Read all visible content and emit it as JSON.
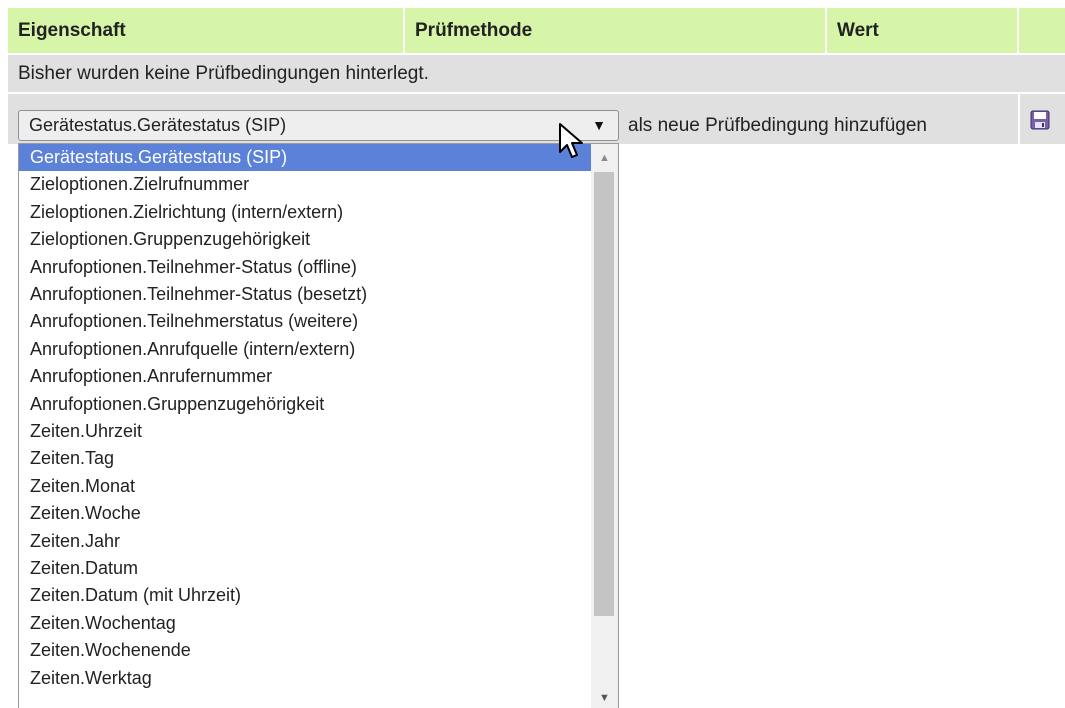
{
  "table": {
    "headers": [
      "Eigenschaft",
      "Prüfmethode",
      "Wert"
    ],
    "empty_message": "Bisher wurden keine Prüfbedingungen hinterlegt."
  },
  "add_condition": {
    "selected_value": "Gerätestatus.Gerätestatus (SIP)",
    "label": "als neue Prüfbedingung hinzufügen",
    "save_icon": "floppy-disk-save-icon"
  },
  "dropdown": {
    "selected_index": 0,
    "options": [
      "Gerätestatus.Gerätestatus (SIP)",
      "Zieloptionen.Zielrufnummer",
      "Zieloptionen.Zielrichtung (intern/extern)",
      "Zieloptionen.Gruppenzugehörigkeit",
      "Anrufoptionen.Teilnehmer-Status (offline)",
      "Anrufoptionen.Teilnehmer-Status (besetzt)",
      "Anrufoptionen.Teilnehmerstatus (weitere)",
      "Anrufoptionen.Anrufquelle (intern/extern)",
      "Anrufoptionen.Anrufernummer",
      "Anrufoptionen.Gruppenzugehörigkeit",
      "Zeiten.Uhrzeit",
      "Zeiten.Tag",
      "Zeiten.Monat",
      "Zeiten.Woche",
      "Zeiten.Jahr",
      "Zeiten.Datum",
      "Zeiten.Datum (mit Uhrzeit)",
      "Zeiten.Wochentag",
      "Zeiten.Wochenende",
      "Zeiten.Werktag"
    ]
  },
  "colors": {
    "header_bg": "#d6f5a8",
    "row_bg": "#e0e0e0",
    "selected_option_bg": "#5b81d9"
  }
}
